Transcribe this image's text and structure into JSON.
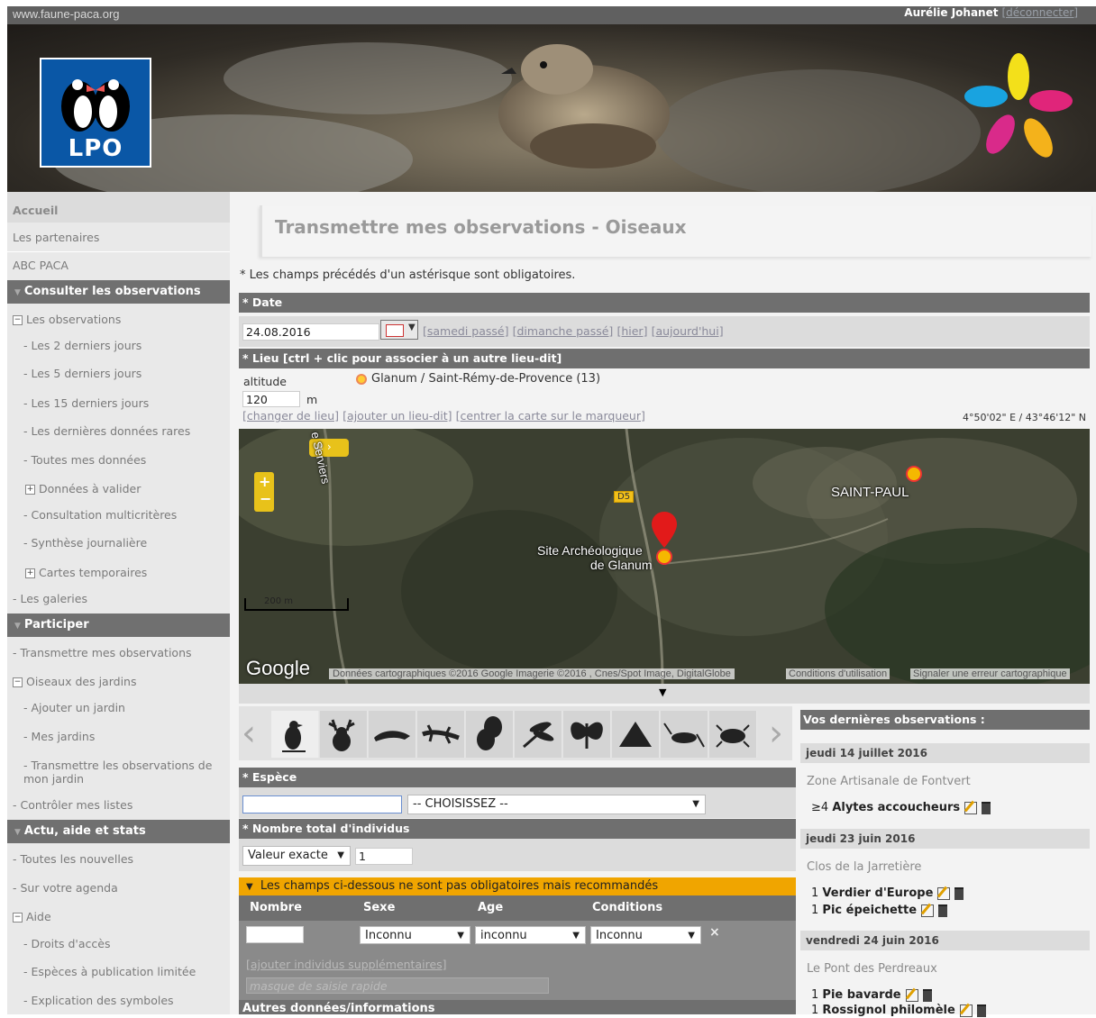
{
  "top_bar": {
    "site_url": "www.faune-paca.org",
    "user_name": "Aurélie Johanet",
    "disconnect_label": "[déconnecter]"
  },
  "banner": {
    "logo_text": "LPO"
  },
  "sidebar": {
    "accueil": "Accueil",
    "partenaires": "Les partenaires",
    "abc": "ABC PACA",
    "consulter_head": "Consulter les observations",
    "les_observations": "Les observations",
    "obs_items": [
      "- Les 2 derniers jours",
      "- Les 5 derniers jours",
      "- Les 15 derniers jours",
      "- Les dernières données rares",
      "- Toutes mes données"
    ],
    "donnees_valider": "Données à valider",
    "consultation": "- Consultation multicritères",
    "synthese": "- Synthèse journalière",
    "cartes": "Cartes temporaires",
    "galeries": "- Les galeries",
    "participer_head": "Participer",
    "transmettre": "- Transmettre mes observations",
    "oiseaux_jardins": "Oiseaux des jardins",
    "ajouter_jardin": "- Ajouter un jardin",
    "mes_jardins": "- Mes jardins",
    "transmettre_jardin": "- Transmettre les observations de mon jardin",
    "controler": "- Contrôler mes listes",
    "actu_head": "Actu, aide et stats",
    "nouvelles": "- Toutes les nouvelles",
    "agenda": "- Sur votre agenda",
    "aide": "Aide",
    "droits": "- Droits d'accès",
    "especes_pub": "- Espèces à publication limitée",
    "explication": "- Explication des symboles"
  },
  "main": {
    "title": "Transmettre mes observations - Oiseaux",
    "required_note": "* Les champs précédés d'un astérisque sont obligatoires.",
    "date_head": "* Date",
    "date_value": "24.08.2016",
    "date_links": [
      "[samedi passé]",
      "[dimanche passé]",
      "[hier]",
      "[aujourd'hui]"
    ],
    "lieu_head": "* Lieu [ctrl + clic pour associer à un autre lieu-dit]",
    "altitude_label": "altitude",
    "altitude_value": "120",
    "altitude_unit": "m",
    "place_name": "Glanum / Saint-Rémy-de-Provence (13)",
    "lieu_links": [
      "[changer de lieu]",
      "[ajouter un lieu-dit]",
      "[centrer la carte sur le marqueur]"
    ],
    "coords": "4°50'02\" E / 43°46'12\" N",
    "map": {
      "label_serviers": "e Serviers",
      "label_d5": "D5",
      "label_saint_paul": "SAINT-PAUL",
      "label_site": "Site Archéologique",
      "label_site2": "de Glanum",
      "scale_label": "200 m",
      "google": "Google",
      "attribution": "Données cartographiques ©2016 Google Imagerie ©2016 , Cnes/Spot Image, DigitalGlobe",
      "conditions": "Conditions d'utilisation",
      "signal": "Signaler une erreur cartographique"
    },
    "espece_head": "* Espèce",
    "espece_select": "-- CHOISISSEZ --",
    "nombre_head": "* Nombre total d'individus",
    "nombre_type": "Valeur exacte",
    "nombre_value": "1",
    "orange_bar": "Les champs ci-dessous ne sont pas obligatoires mais recommandés",
    "det_cols": [
      "Nombre",
      "Sexe",
      "Age",
      "Conditions"
    ],
    "sexe_value": "Inconnu",
    "age_value": "inconnu",
    "conditions_value": "Inconnu",
    "ajouter_individus": "[ajouter individus supplémentaires]",
    "masque_placeholder": "masque de saisie rapide",
    "autres_head": "Autres données/informations"
  },
  "species_icons": [
    "bird-icon",
    "deer-icon",
    "dolphin-icon",
    "lizard-icon",
    "squirrel-icon",
    "dragonfly-icon",
    "butterfly-icon",
    "grasshopper-icon",
    "cricket-icon",
    "beetle-icon"
  ],
  "recent": {
    "head": "Vos dernières observations :",
    "groups": [
      {
        "date": "jeudi 14 juillet 2016",
        "place": "Zone Artisanale de Fontvert",
        "entries": [
          {
            "count": "≥4",
            "species": "Alytes accoucheurs"
          }
        ]
      },
      {
        "date": "jeudi 23 juin 2016",
        "place": "Clos de la Jarretière",
        "entries": [
          {
            "count": "1",
            "species": "Verdier d'Europe"
          },
          {
            "count": "1",
            "species": "Pic épeichette"
          }
        ]
      },
      {
        "date": "vendredi 24 juin 2016",
        "place": "Le Pont des Perdreaux",
        "entries": [
          {
            "count": "1",
            "species": "Pie bavarde"
          },
          {
            "count": "1",
            "species": "Rossignol philomèle"
          }
        ]
      }
    ]
  }
}
